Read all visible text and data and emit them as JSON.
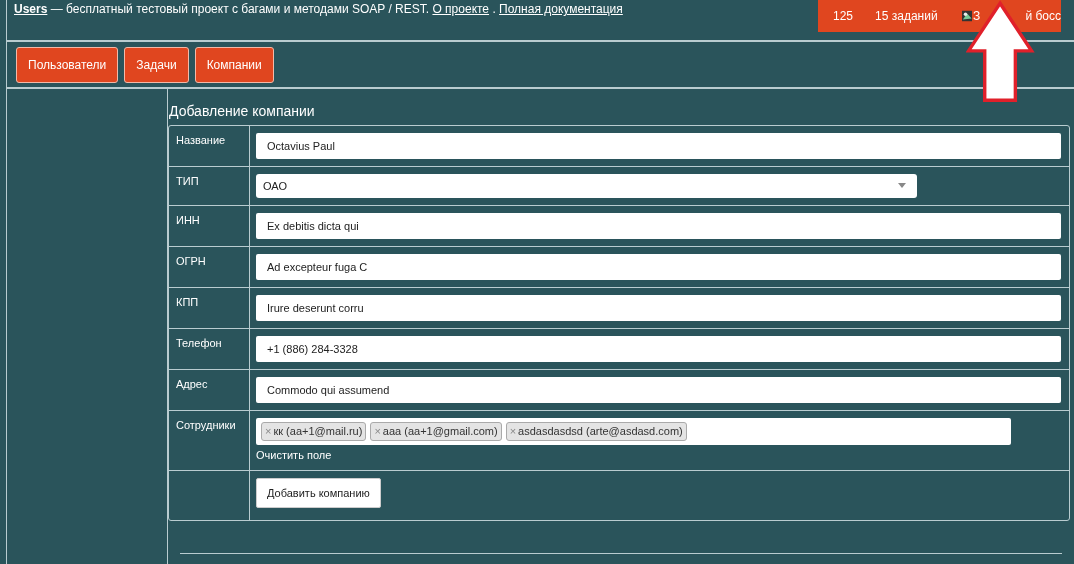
{
  "header": {
    "brand": "Users",
    "tagline": " — бесплатный тестовый проект с багами и методами SOAP / REST. ",
    "links": [
      "О проекте",
      "Полная документация"
    ],
    "separator": " . "
  },
  "user_panel": {
    "score": "125",
    "tasks": "15 заданий",
    "name_start": "З",
    "name_end": "й босс"
  },
  "nav": [
    {
      "label": "Пользователи"
    },
    {
      "label": "Задачи"
    },
    {
      "label": "Компании"
    }
  ],
  "form": {
    "title": "Добавление компании",
    "rows": [
      {
        "kind": "input",
        "label": "Название",
        "value": "Octavius Paul"
      },
      {
        "kind": "select",
        "label": "ТИП",
        "value": "ОАО"
      },
      {
        "kind": "input",
        "label": "ИНН",
        "value": "Ex debitis dicta qui"
      },
      {
        "kind": "input",
        "label": "ОГРН",
        "value": "Ad excepteur fuga C"
      },
      {
        "kind": "input",
        "label": "КПП",
        "value": "Irure deserunt corru"
      },
      {
        "kind": "input",
        "label": "Телефон",
        "value": "+1 (886) 284-3328"
      },
      {
        "kind": "input",
        "label": "Адрес",
        "value": "Commodo qui assumend"
      },
      {
        "kind": "tags",
        "label": "Сотрудники",
        "tags": [
          "кк (aa+1@mail.ru)",
          "aaa (aa+1@gmail.com)",
          "asdasdasdsd (arte@asdasd.com)"
        ],
        "remove_mark": "×",
        "clear_link": "Очистить поле"
      },
      {
        "kind": "submit",
        "button": "Добавить компанию"
      }
    ]
  }
}
